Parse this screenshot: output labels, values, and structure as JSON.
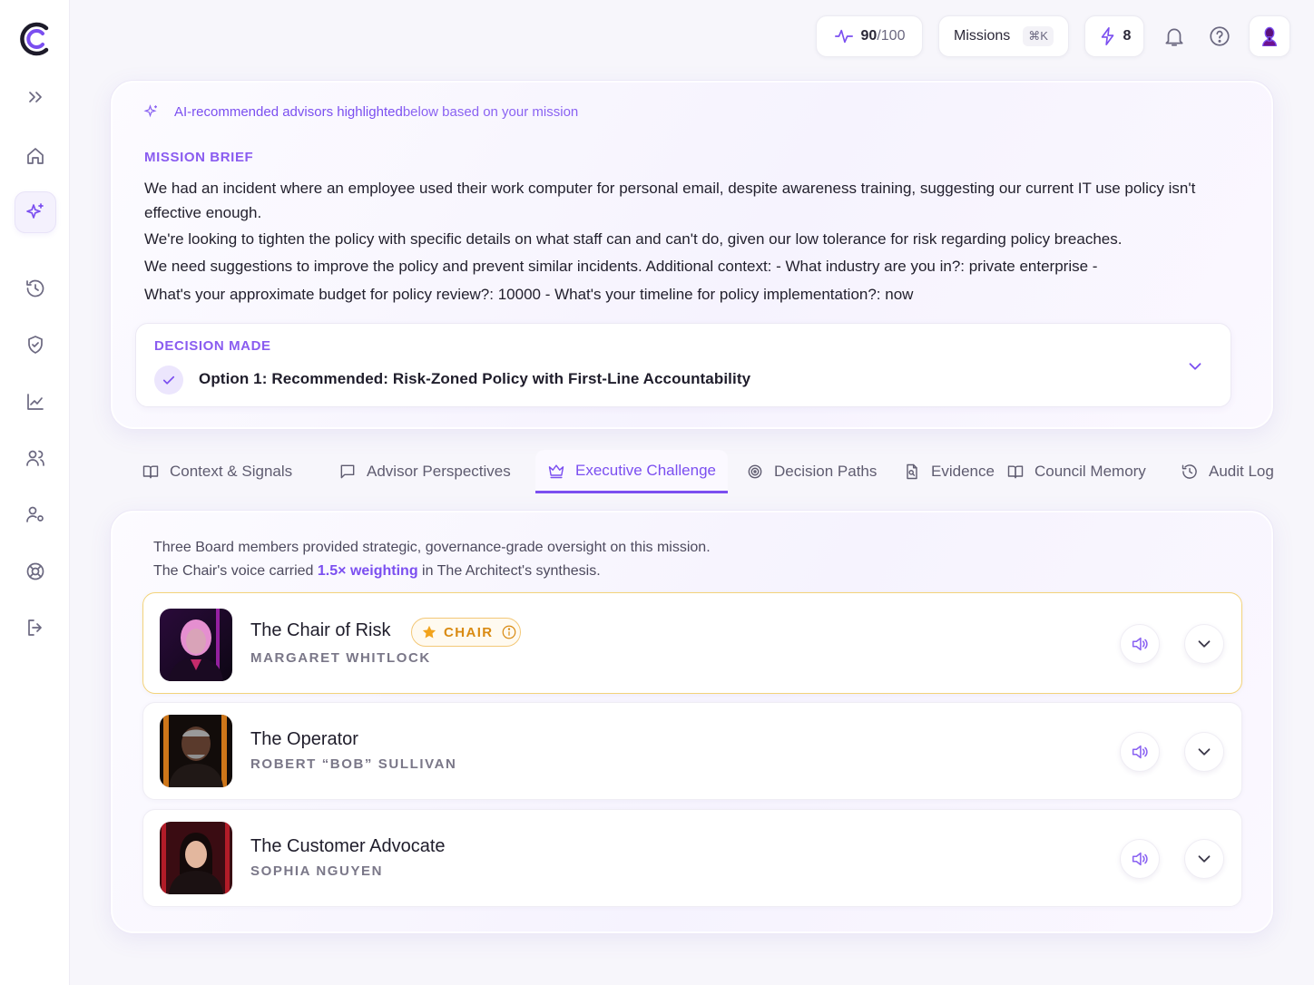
{
  "topbar": {
    "score": "90",
    "score_total": "/100",
    "missions_label": "Missions",
    "missions_shortcut": "⌘K",
    "energy_count": "8"
  },
  "mission": {
    "ai_prefix": "AI-recommended advisors highlighted",
    "ai_suffix": " below based on your mission",
    "brief_label": "MISSION BRIEF",
    "brief_lines": [
      "We had an incident where an employee used their work computer for personal email, despite awareness training, suggesting our current IT use policy isn't effective enough.",
      "We're looking to tighten the policy with specific details on what staff can and can't do, given our low tolerance for risk regarding policy breaches.",
      "We need suggestions to improve the policy and prevent similar incidents. Additional context: - What industry are you in?: private enterprise -",
      "What's your approximate budget for policy review?: 10000 - What's your timeline for policy implementation?: now"
    ],
    "decision_label": "DECISION MADE",
    "decision_text": "Option 1: Recommended: Risk-Zoned Policy with First-Line Accountability"
  },
  "tabs": [
    {
      "label": "Context & Signals"
    },
    {
      "label": "Advisor Perspectives"
    },
    {
      "label": "Executive Challenge"
    },
    {
      "label": "Decision Paths"
    },
    {
      "label": "Evidence"
    },
    {
      "label": "Council Memory"
    },
    {
      "label": "Audit Log"
    }
  ],
  "executive": {
    "intro_line1": "Three Board members provided strategic, governance-grade oversight on this mission.",
    "intro_line2_prefix": "The Chair's voice carried ",
    "intro_weight": "1.5× weighting",
    "intro_line2_suffix": " in The Architect's synthesis.",
    "chair_badge": "CHAIR",
    "members": [
      {
        "title": "The Chair of Risk",
        "name": "MARGARET WHITLOCK"
      },
      {
        "title": "The Operator",
        "name": "ROBERT “BOB” SULLIVAN"
      },
      {
        "title": "The Customer Advocate",
        "name": "SOPHIA NGUYEN"
      }
    ]
  },
  "colors": {
    "accent": "#7b4ff0",
    "chair_gold": "#f3c877"
  }
}
